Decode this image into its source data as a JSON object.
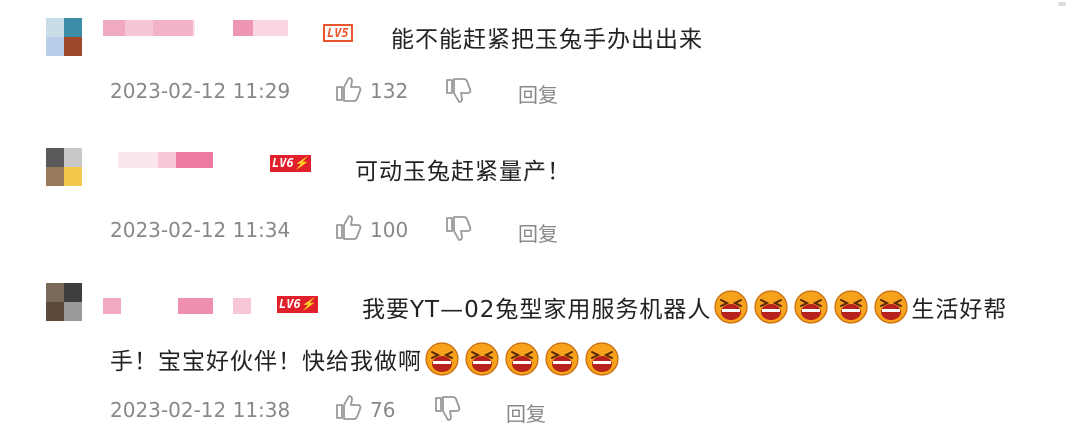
{
  "comments": [
    {
      "level": "LV5",
      "text": "能不能赶紧把玉兔手办出出来",
      "time": "2023-02-12 11:29",
      "likes": "132",
      "reply": "回复"
    },
    {
      "level": "LV6⚡",
      "text": "可动玉兔赶紧量产！",
      "time": "2023-02-12 11:34",
      "likes": "100",
      "reply": "回复"
    },
    {
      "level": "LV6⚡",
      "text_line1": "我要YT—02兔型家用服务机器人",
      "text_line1_end": "生活好帮",
      "text_line2": "手！宝宝好伙伴！快给我做啊",
      "time": "2023-02-12 11:38",
      "likes": "76",
      "reply": "回复"
    }
  ],
  "icons": {
    "like": "thumbs-up-icon",
    "dislike": "thumbs-down-icon",
    "emoji": "laughing-crying-emoji-icon"
  },
  "colors": {
    "badge_outline": "#e8562a",
    "badge_solid": "#e0202a",
    "meta_gray": "#888888",
    "text": "#222222"
  }
}
